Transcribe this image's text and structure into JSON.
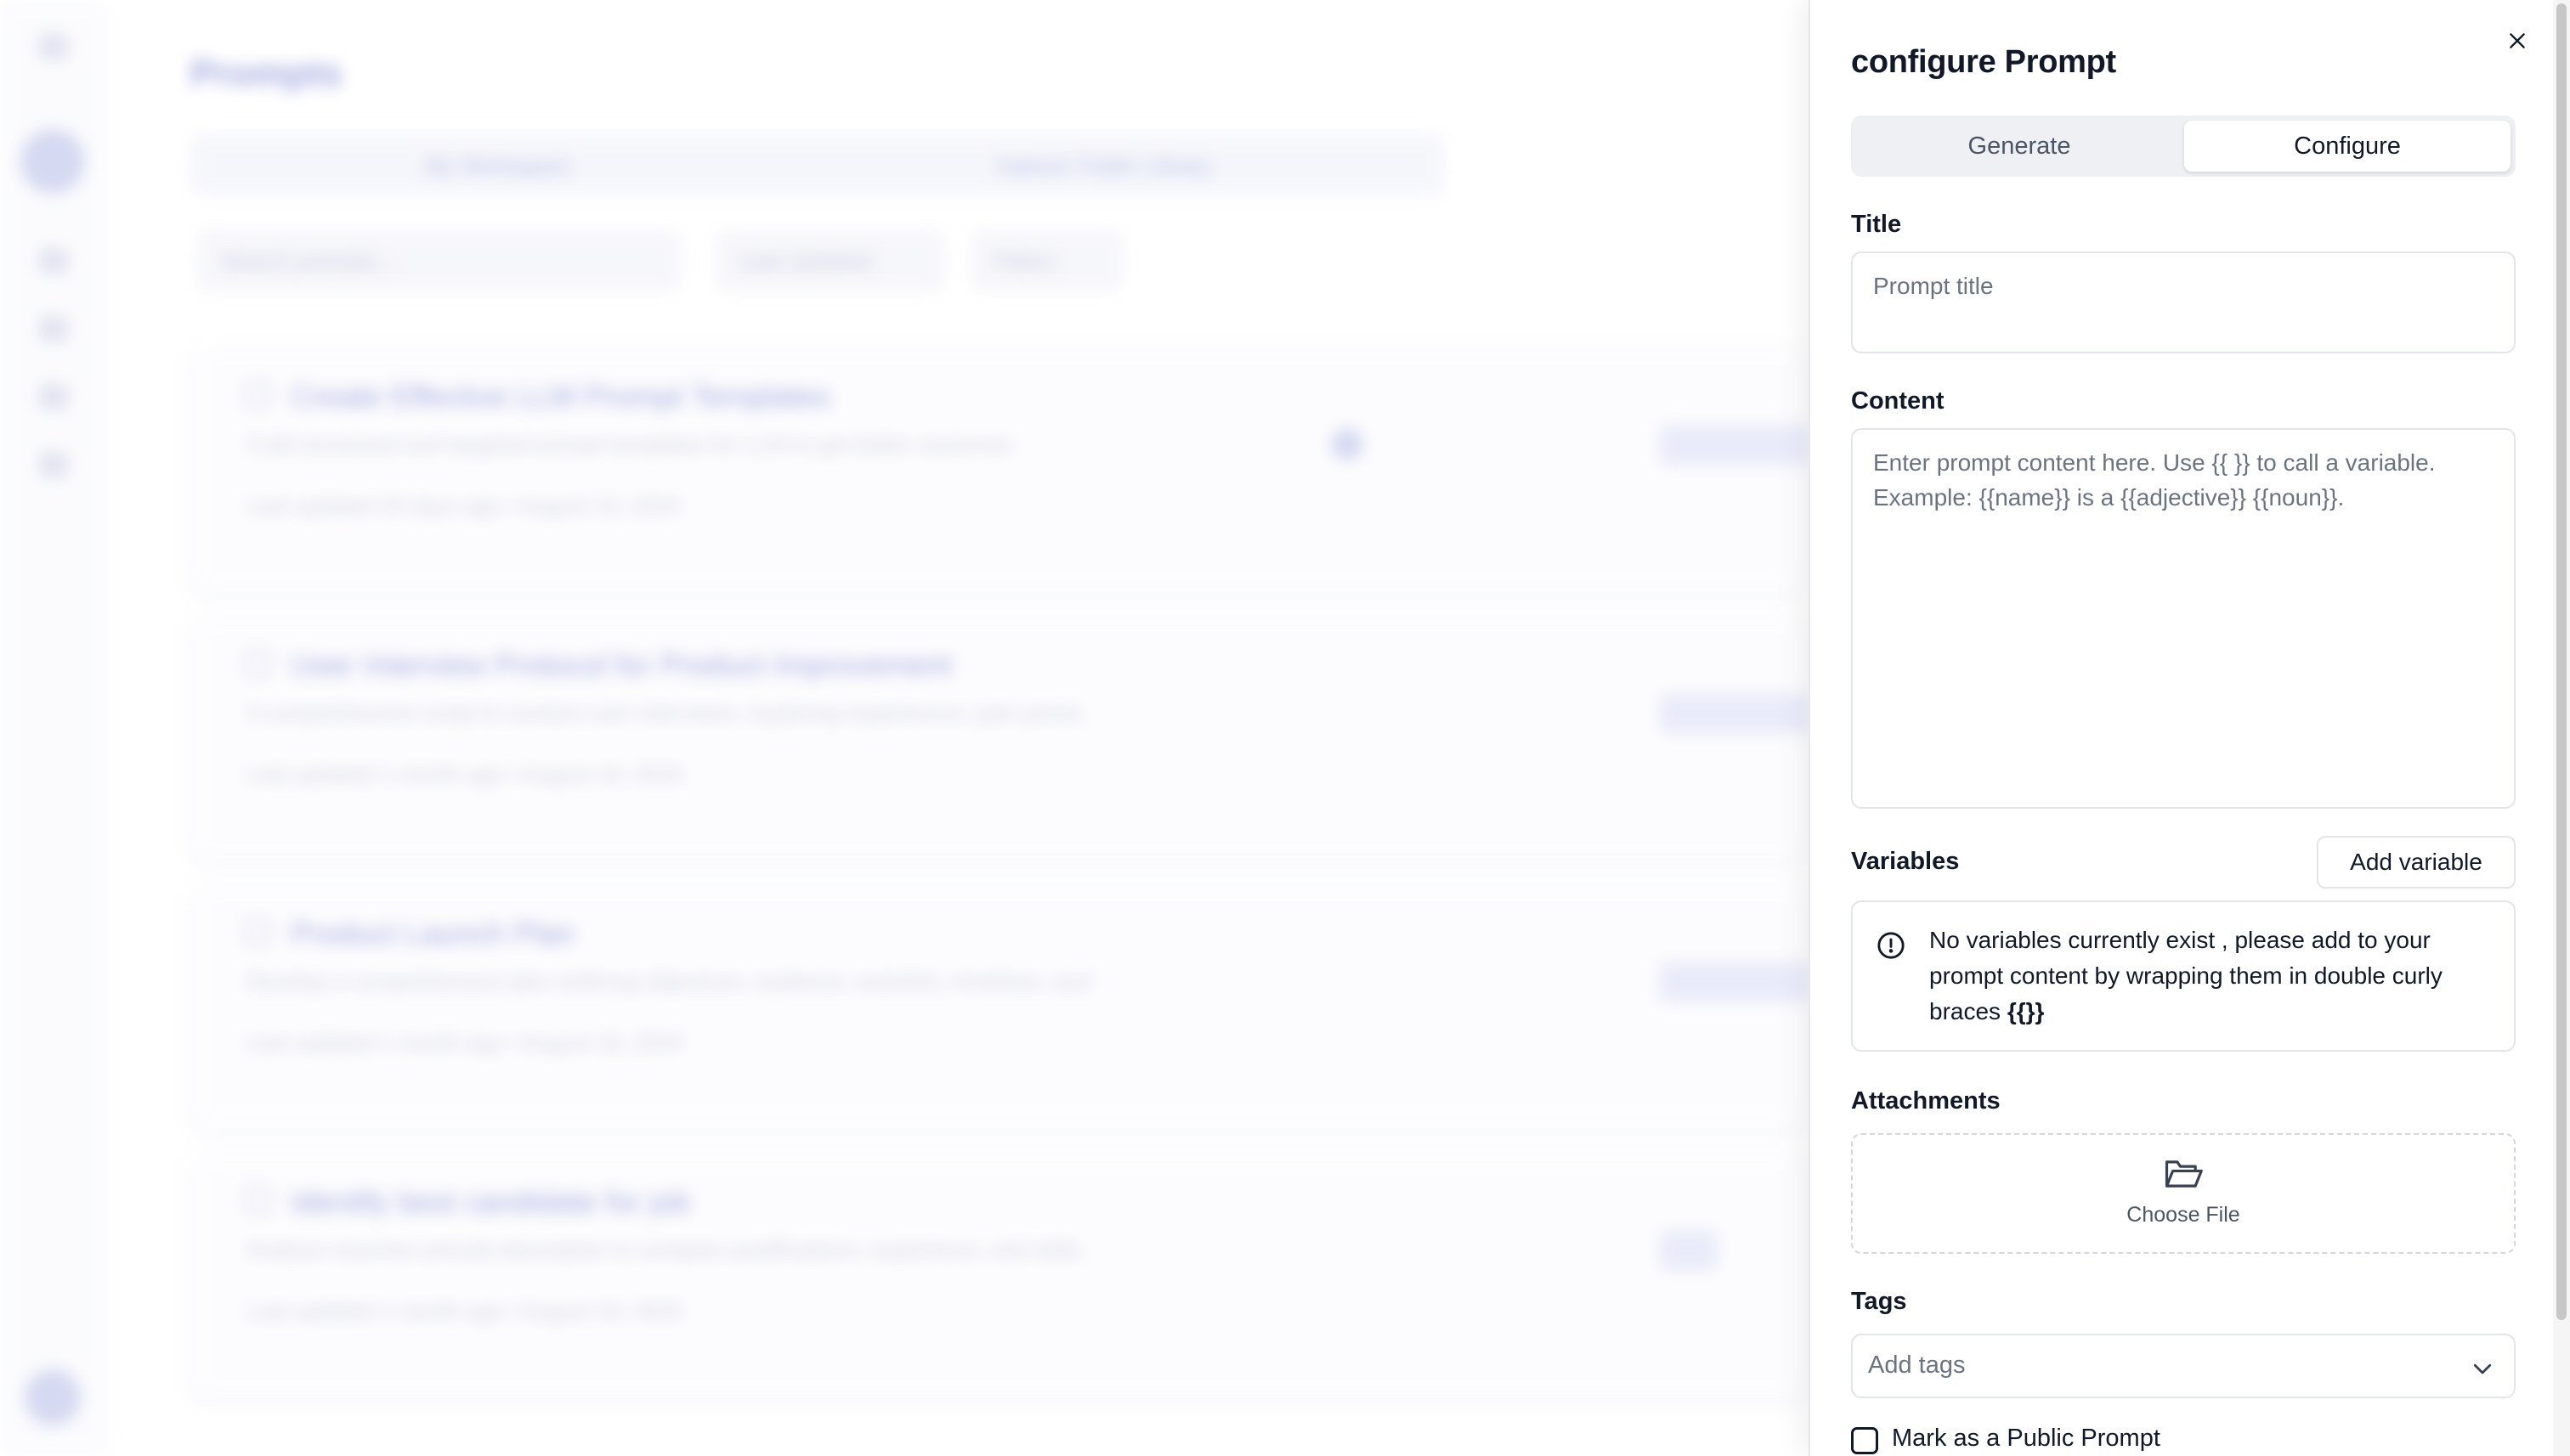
{
  "background": {
    "page_title": "Prompts",
    "tabs": [
      "My Workspace",
      "Katonic Public Library"
    ],
    "search_placeholder": "Search prompts...",
    "sort_label": "Last Updated",
    "filter_label": "Filters",
    "cards": [
      {
        "title": "Create Effective LLM Prompt Templates",
        "description": "Craft structured and targeted prompt templates for LLM to get better outcomes",
        "meta": "Last updated 25 days ago  •  August 16, 2024"
      },
      {
        "title": "User Interview Protocol for Product Improvement",
        "description": "A comprehensive script to conduct user interviews, exploring experiences, pain points",
        "meta": "Last updated 1 month ago  •  August 16, 2024"
      },
      {
        "title": "Product Launch Plan",
        "description": "Develop a comprehensive plan outlining objectives, audience, activities, timelines, and",
        "meta": "Last updated 1 month ago  •  August 16, 2024"
      },
      {
        "title": "Identify best candidate for job",
        "description": "Analyze resumes and job description to compare qualifications, experience, and skills",
        "meta": "Last updated 1 month ago  •  August 16, 2024"
      }
    ]
  },
  "drawer": {
    "title": "configure Prompt",
    "tabs": {
      "generate": "Generate",
      "configure": "Configure"
    },
    "active_tab": "Configure",
    "title_field": {
      "label": "Title",
      "placeholder": "Prompt title"
    },
    "content_field": {
      "label": "Content",
      "placeholder": "Enter prompt content here. Use {{ }} to call a variable. Example: {{name}} is a {{adjective}} {{noun}}."
    },
    "variables": {
      "label": "Variables",
      "add_button": "Add variable",
      "empty_message": "No variables currently exist , please add to your prompt content by wrapping them in double curly braces",
      "empty_message_code": "{{}}"
    },
    "attachments": {
      "label": "Attachments",
      "choose_file": "Choose File"
    },
    "tags": {
      "label": "Tags",
      "placeholder": "Add tags"
    },
    "public_prompt": {
      "label": "Mark as a Public Prompt",
      "checked": false
    }
  },
  "icons": {
    "close": "close-icon",
    "alert": "info-circle-icon",
    "folder": "folder-open-icon",
    "chevron": "chevron-down-icon"
  }
}
